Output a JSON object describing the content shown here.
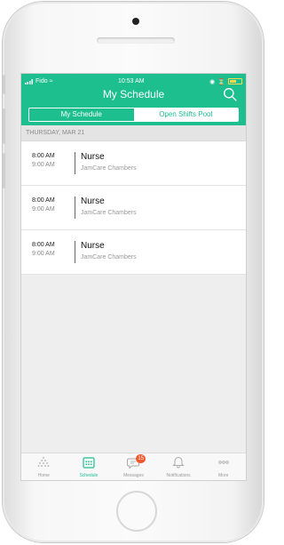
{
  "status_bar": {
    "carrier": "Fido",
    "time": "10:53 AM"
  },
  "header": {
    "title": "My Schedule"
  },
  "segmented": {
    "tabs": [
      {
        "label": "My Schedule"
      },
      {
        "label": "Open Shifts Pool"
      }
    ]
  },
  "day": {
    "label": "THURSDAY, MAR 21"
  },
  "shifts": [
    {
      "start": "8:00 AM",
      "end": "9:00 AM",
      "role": "Nurse",
      "location": "JamCare Chambers"
    },
    {
      "start": "8:00 AM",
      "end": "9:00 AM",
      "role": "Nurse",
      "location": "JamCare Chambers"
    },
    {
      "start": "8:00 AM",
      "end": "9:00 AM",
      "role": "Nurse",
      "location": "JamCare Chambers"
    }
  ],
  "tabbar": {
    "items": [
      {
        "label": "Home",
        "icon": "home-dots-icon"
      },
      {
        "label": "Schedule",
        "icon": "calendar-icon"
      },
      {
        "label": "Messages",
        "icon": "chat-bubble-icon",
        "badge": "15"
      },
      {
        "label": "Notifications",
        "icon": "bell-icon"
      },
      {
        "label": "More",
        "icon": "more-dots-icon"
      }
    ]
  },
  "colors": {
    "accent": "#1dbf8f",
    "badge": "#f2572b",
    "battery": "#ffd84d"
  }
}
